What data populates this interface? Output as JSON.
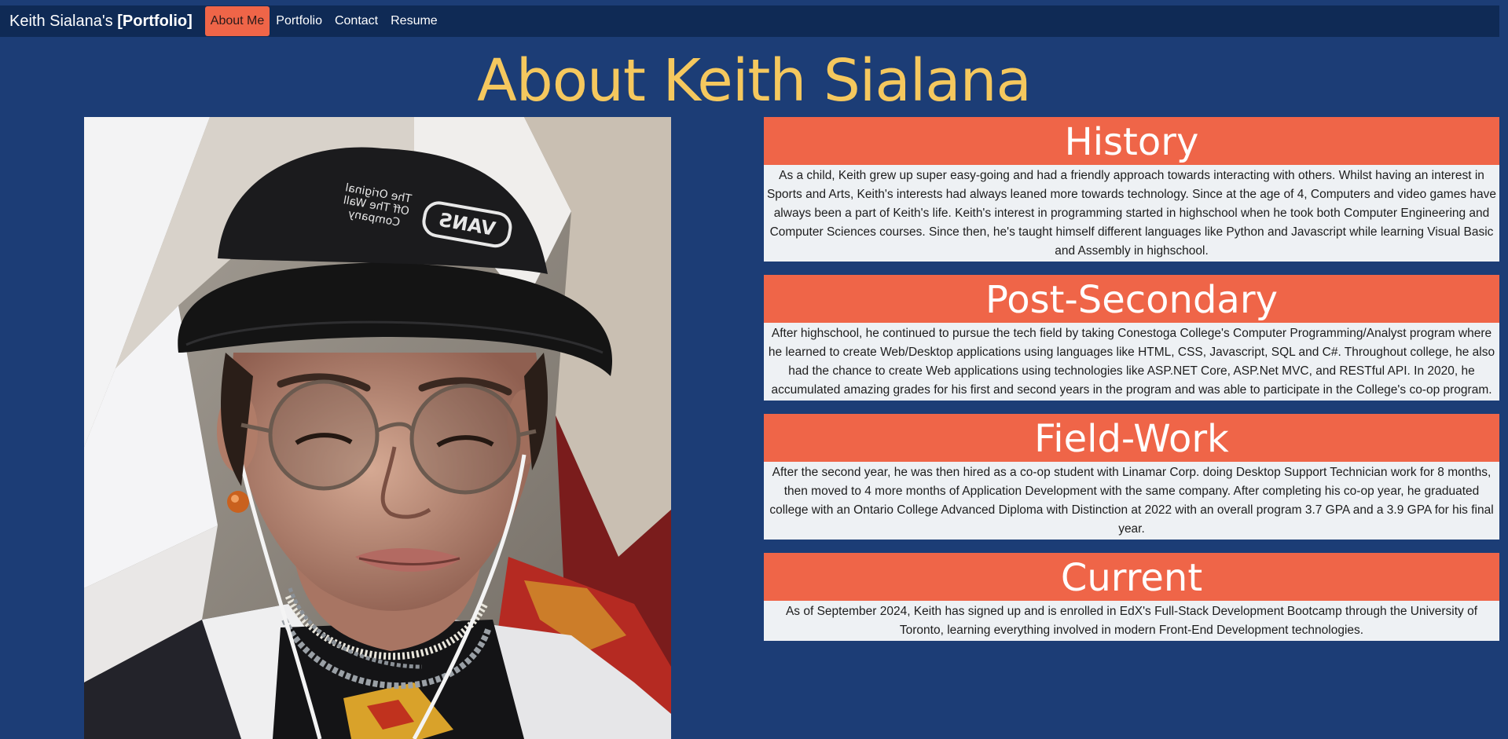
{
  "nav": {
    "brand_name": "Keith Sialana's ",
    "brand_bold": "[Portfolio]",
    "links": [
      {
        "label": "About Me",
        "active": true
      },
      {
        "label": "Portfolio",
        "active": false
      },
      {
        "label": "Contact",
        "active": false
      },
      {
        "label": "Resume",
        "active": false
      }
    ]
  },
  "page": {
    "title": "About Keith Sialana"
  },
  "sections": [
    {
      "heading": "History",
      "body": "As a child, Keith grew up super easy-going and had a friendly approach towards interacting with others. Whilst having an interest in Sports and Arts, Keith's interests had always leaned more towards technology. Since at the age of 4, Computers and video games have always been a part of Keith's life. Keith's interest in programming started in highschool when he took both Computer Engineering and Computer Sciences courses. Since then, he's taught himself different languages like Python and Javascript while learning Visual Basic and Assembly in highschool."
    },
    {
      "heading": "Post-Secondary",
      "body": "After highschool, he continued to pursue the tech field by taking Conestoga College's Computer Programming/Analyst program where he learned to create Web/Desktop applications using languages like HTML, CSS, Javascript, SQL and C#. Throughout college, he also had the chance to create Web applications using technologies like ASP.NET Core, ASP.Net MVC, and RESTful API. In 2020, he accumulated amazing grades for his first and second years in the program and was able to participate in the College's co-op program."
    },
    {
      "heading": "Field-Work",
      "body": "After the second year, he was then hired as a co-op student with Linamar Corp. doing Desktop Support Technician work for 8 months, then moved to 4 more months of Application Development with the same company. After completing his co-op year, he graduated college with an Ontario College Advanced Diploma with Distinction at 2022 with an overall program 3.7 GPA and a 3.9 GPA for his final year."
    },
    {
      "heading": "Current",
      "body": "As of September 2024, Keith has signed up and is enrolled in EdX's Full-Stack Development Bootcamp through the University of Toronto, learning everything involved in modern Front-End Development technologies."
    }
  ],
  "photo": {
    "hat_text_line1": "The Original",
    "hat_text_line2": "Off The Wall",
    "hat_text_line3": "Company",
    "hat_logo": "VANS"
  },
  "colors": {
    "background": "#1c3d76",
    "navbar": "#0f2a55",
    "accent": "#ef6548",
    "title": "#f5c85e",
    "section_body": "#eef1f4"
  }
}
